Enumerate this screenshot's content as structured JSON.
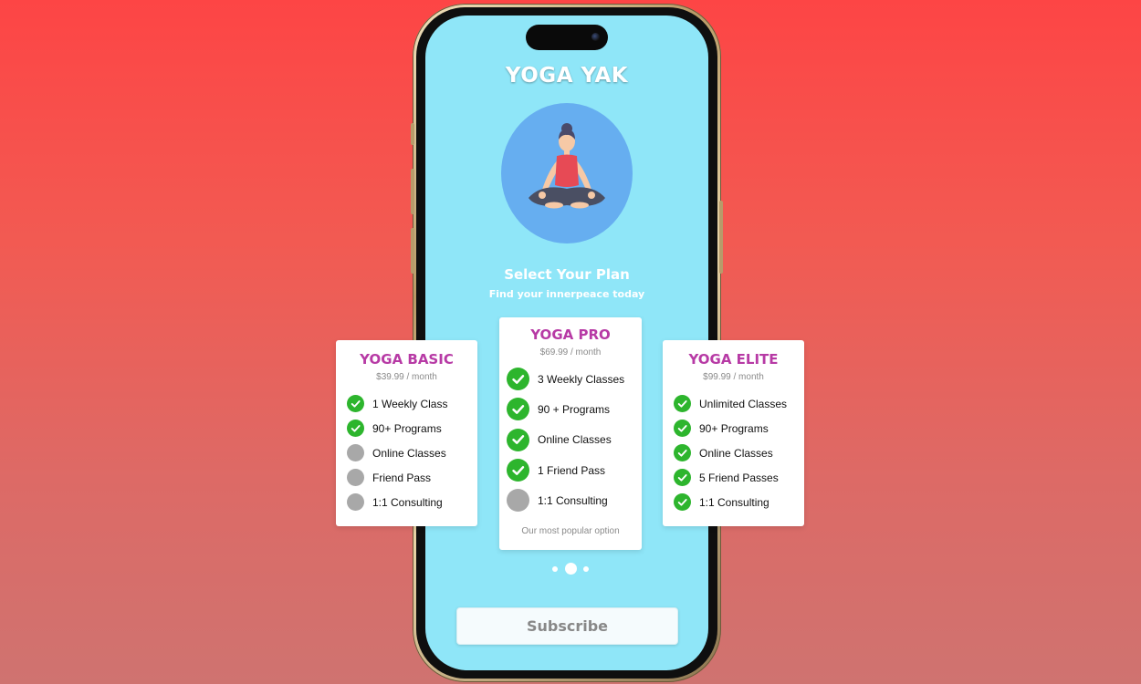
{
  "app": {
    "title": "YOGA YAK"
  },
  "hero": {
    "icon": "meditation-illustration",
    "avatar_color": "#66aef0"
  },
  "header": {
    "title": "Select Your Plan",
    "subtitle": "Find your innerpeace today"
  },
  "plans": [
    {
      "name": "YOGA BASIC",
      "price": "$39.99 / month",
      "features": [
        {
          "label": "1 Weekly Class",
          "included": true
        },
        {
          "label": "90+ Programs",
          "included": true
        },
        {
          "label": "Online Classes",
          "included": false
        },
        {
          "label": "Friend Pass",
          "included": false
        },
        {
          "label": "1:1 Consulting",
          "included": false
        }
      ]
    },
    {
      "name": "YOGA PRO",
      "price": "$69.99 / month",
      "features": [
        {
          "label": "3 Weekly Classes",
          "included": true
        },
        {
          "label": "90 + Programs",
          "included": true
        },
        {
          "label": "Online Classes",
          "included": true
        },
        {
          "label": "1 Friend Pass",
          "included": true
        },
        {
          "label": "1:1 Consulting",
          "included": false
        }
      ],
      "note": "Our most popular option"
    },
    {
      "name": "YOGA ELITE",
      "price": "$99.99 / month",
      "features": [
        {
          "label": "Unlimited Classes",
          "included": true
        },
        {
          "label": "90+ Programs",
          "included": true
        },
        {
          "label": "Online Classes",
          "included": true
        },
        {
          "label": "5 Friend Passes",
          "included": true
        },
        {
          "label": "1:1 Consulting",
          "included": true
        }
      ]
    }
  ],
  "pager": {
    "count": 3,
    "active_index": 1
  },
  "subscribe": {
    "label": "Subscribe"
  },
  "colors": {
    "screen_bg": "#8fe6f8",
    "plan_name": "#b73aa5",
    "check_on": "#2db52d",
    "check_off": "#a8a8a8",
    "background_top": "#fd4545",
    "background_bottom": "#cf7370"
  }
}
